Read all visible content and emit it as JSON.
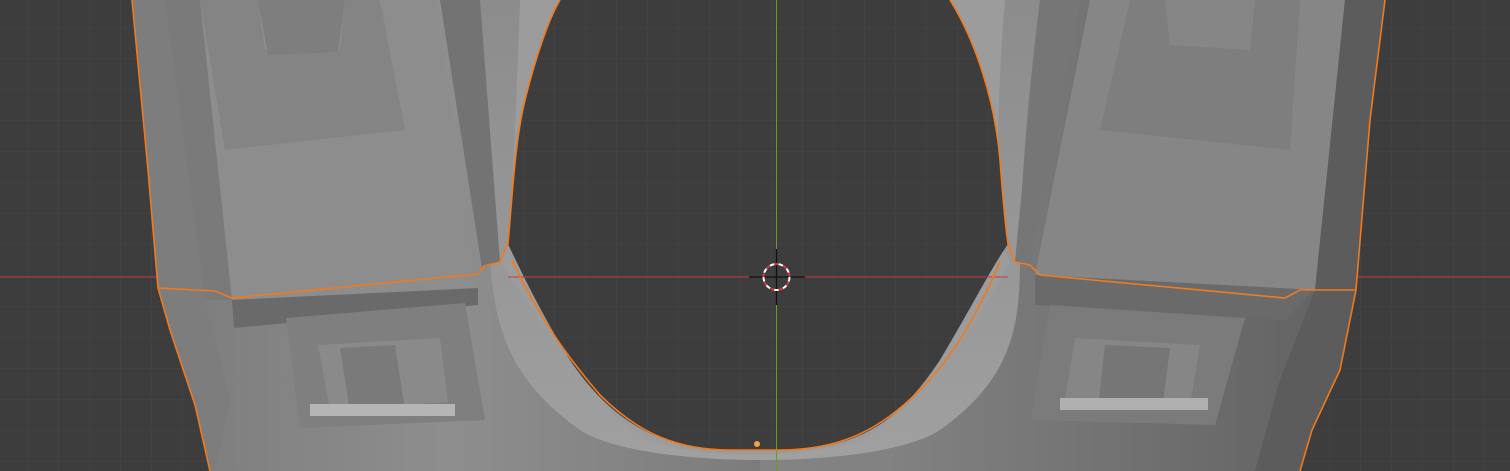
{
  "viewport": {
    "background": "#3d3d3d",
    "grid_minor_color": "#454545",
    "grid_major_color": "#4a4a4a",
    "x_axis_color": "#c43a3a",
    "y_axis_color": "#6a9a2a",
    "selection_outline_color": "#f07a1e",
    "active_outline_color": "#f5a341",
    "mesh_color": "#8a8a8a",
    "origin_point_color": "#f5a341"
  },
  "icons": {
    "cursor": "3d-cursor-icon",
    "origin": "object-origin-icon"
  }
}
